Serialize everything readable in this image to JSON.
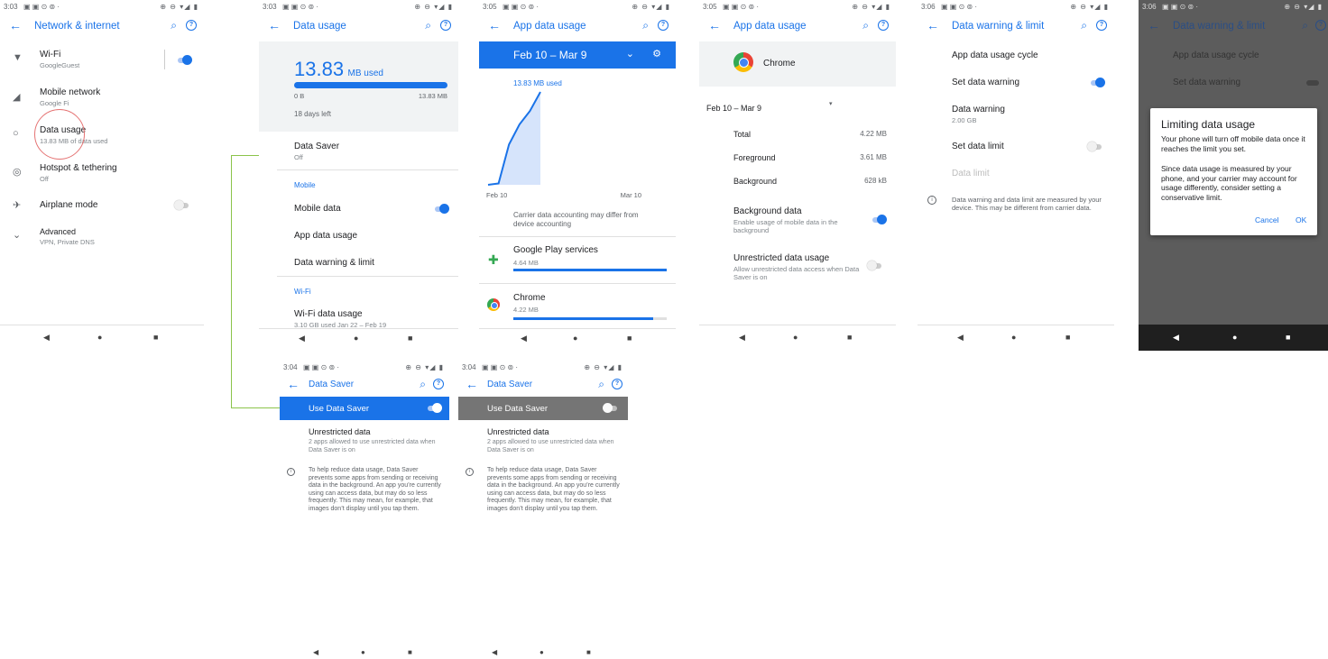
{
  "s1": {
    "time": "3:03",
    "status_icons": "▣ ▣ ⊙ ⊚ ·",
    "sys_icons": "⊕ ⊖ ▾◢ ▮",
    "title": "Network & internet",
    "items": [
      {
        "label": "Wi-Fi",
        "sub": "GoogleGuest"
      },
      {
        "label": "Mobile network",
        "sub": "Google Fi"
      },
      {
        "label": "Data usage",
        "sub": "13.83 MB of data used"
      },
      {
        "label": "Hotspot & tethering",
        "sub": "Off"
      },
      {
        "label": "Airplane mode",
        "sub": ""
      },
      {
        "label": "Advanced",
        "sub": "VPN, Private DNS"
      }
    ]
  },
  "s2": {
    "time": "3:03",
    "title": "Data usage",
    "used_value": "13.83",
    "used_unit": "MB used",
    "bar_min": "0 B",
    "bar_max": "13.83 MB",
    "days_left": "18 days left",
    "data_saver_label": "Data Saver",
    "data_saver_sub": "Off",
    "mobile_section": "Mobile",
    "mobile_data": "Mobile data",
    "app_data_usage": "App data usage",
    "warning_limit": "Data warning & limit",
    "wifi_section": "Wi-Fi",
    "wifi_usage": "Wi-Fi data usage",
    "wifi_usage_sub": "3.10 GB used Jan 22 – Feb 19"
  },
  "s3": {
    "time": "3:05",
    "title": "App data usage",
    "range": "Feb 10 – Mar 9",
    "chart_used": "13.83 MB used",
    "x_start": "Feb 10",
    "x_end": "Mar 10",
    "note": "Carrier data accounting may differ from device accounting",
    "apps": [
      {
        "name": "Google Play services",
        "size": "4.64 MB",
        "fill": 1.0
      },
      {
        "name": "Chrome",
        "size": "4.22 MB",
        "fill": 0.91
      }
    ]
  },
  "chart_data": {
    "type": "line",
    "title": "13.83 MB used",
    "x": [
      "Feb 10",
      "Mar 10"
    ],
    "series": [
      {
        "values": [
          0,
          0.2,
          6,
          9,
          11,
          13.83
        ]
      }
    ]
  },
  "s4": {
    "time": "3:05",
    "title": "App data usage",
    "app": "Chrome",
    "range": "Feb 10 – Mar 9",
    "rows": [
      {
        "label": "Total",
        "value": "4.22 MB"
      },
      {
        "label": "Foreground",
        "value": "3.61 MB"
      },
      {
        "label": "Background",
        "value": "628 kB"
      }
    ],
    "bg_label": "Background data",
    "bg_sub": "Enable usage of mobile data in the background",
    "unres_label": "Unrestricted data usage",
    "unres_sub": "Allow unrestricted data access when Data Saver is on"
  },
  "s5": {
    "time": "3:06",
    "title": "Data warning & limit",
    "cycle": "App data usage cycle",
    "set_warning": "Set data warning",
    "warning_label": "Data warning",
    "warning_value": "2.00 GB",
    "set_limit": "Set data limit",
    "limit_label": "Data limit",
    "info": "Data warning and data limit are measured by your device. This may be different from carrier data."
  },
  "s6": {
    "time": "3:06",
    "title": "Data warning & limit",
    "cycle": "App data usage cycle",
    "set_warning": "Set data warning",
    "dialog_title": "Limiting data usage",
    "dialog_p1": "Your phone will turn off mobile data once it reaches the limit you set.",
    "dialog_p2": "Since data usage is measured by your phone, and your carrier may account for usage differently, consider setting a conservative limit.",
    "cancel": "Cancel",
    "ok": "OK"
  },
  "s7": {
    "time": "3:04",
    "title": "Data Saver",
    "band": "Use Data Saver",
    "unres": "Unrestricted data",
    "unres_sub": "2 apps allowed to use unrestricted data when Data Saver is on",
    "info": "To help reduce data usage, Data Saver prevents some apps from sending or receiving data in the background. An app you’re currently using can access data, but may do so less frequently. This may mean, for example, that images don’t display until you tap them."
  },
  "s8": {
    "time": "3:04",
    "title": "Data Saver",
    "band": "Use Data Saver",
    "unres": "Unrestricted data",
    "unres_sub": "2 apps allowed to use unrestricted data when Data Saver is on",
    "info": "To help reduce data usage, Data Saver prevents some apps from sending or receiving data in the background. An app you’re currently using can access data, but may do so less frequently. This may mean, for example, that images don’t display until you tap them."
  },
  "nav": {
    "back": "◀",
    "home": "●",
    "recents": "■"
  },
  "colors": {
    "accent": "#1a73e8",
    "highlight_circle": "#e57373",
    "connector": "#8bc34a"
  }
}
